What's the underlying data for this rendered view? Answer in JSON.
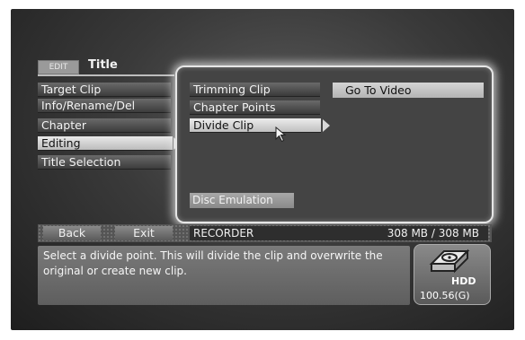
{
  "header": {
    "mode_tab": "EDIT",
    "title": "Title"
  },
  "left_menu": {
    "items": [
      {
        "label": "Target Clip",
        "selected": false
      },
      {
        "label": "Info/Rename/Del",
        "selected": false
      },
      {
        "label": "Chapter",
        "selected": false
      },
      {
        "label": "Editing",
        "selected": true
      },
      {
        "label": "Title Selection",
        "selected": false
      }
    ]
  },
  "sub_menu": {
    "items": [
      {
        "label": "Trimming Clip",
        "selected": false
      },
      {
        "label": "Chapter Points",
        "selected": false
      },
      {
        "label": "Divide Clip",
        "selected": true
      }
    ],
    "action": "Go To Video",
    "disc_emulation": "Disc Emulation"
  },
  "footer": {
    "back_label": "Back",
    "exit_label": "Exit",
    "source": "RECORDER",
    "capacity": "308 MB / 308 MB",
    "help_text": "Select a divide point. This will divide the clip and overwrite the original or create new clip.",
    "hdd_label": "HDD",
    "hdd_free": "100.56(G)"
  },
  "icons": {
    "pointer": "cursor-arrow-icon",
    "drive": "hdd-icon",
    "submenu": "triangle-right-icon"
  }
}
